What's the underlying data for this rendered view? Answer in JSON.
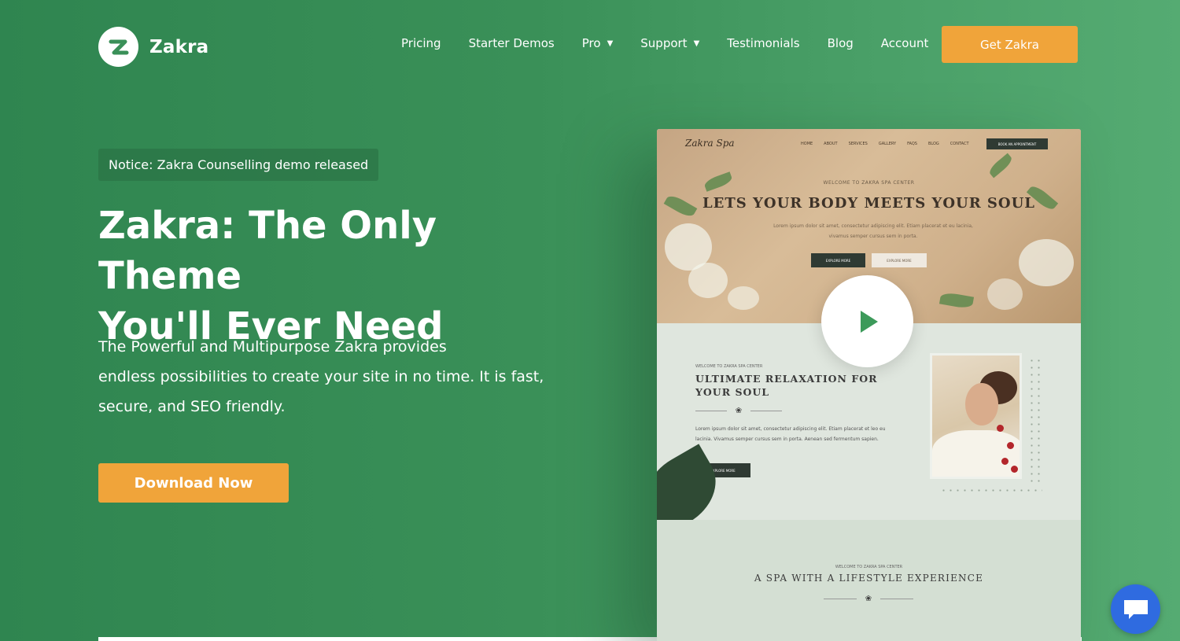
{
  "header": {
    "logo_text": "Zakra",
    "nav": [
      {
        "label": "Pricing",
        "has_dropdown": false
      },
      {
        "label": "Starter Demos",
        "has_dropdown": false
      },
      {
        "label": "Pro",
        "has_dropdown": true
      },
      {
        "label": "Support",
        "has_dropdown": true
      },
      {
        "label": "Testimonials",
        "has_dropdown": false
      },
      {
        "label": "Blog",
        "has_dropdown": false
      },
      {
        "label": "Account",
        "has_dropdown": false
      }
    ],
    "cta_label": "Get Zakra"
  },
  "hero": {
    "notice": "Notice: Zakra Counselling demo released",
    "title_line1": "Zakra: The Only Theme",
    "title_line2": "You'll Ever Need",
    "desc_line1": "The Powerful and Multipurpose Zakra provides",
    "desc_line2": "endless possibilities to create your site in no time. It is fast,",
    "desc_line3": "secure, and SEO friendly.",
    "download_label": "Download Now"
  },
  "preview": {
    "logo": "Zakra Spa",
    "menu": [
      "HOME",
      "ABOUT",
      "SERVICES",
      "GALLERY",
      "FAQS",
      "BLOG",
      "CONTACT"
    ],
    "book_label": "BOOK AN APPOINTMENT",
    "welcome": "WELCOME TO ZAKRA SPA CENTER",
    "title": "LETS YOUR BODY MEETS YOUR SOUL",
    "lorem": "Lorem ipsum dolor sit amet, consectetur adipiscing elit. Etiam placerat et eu lacinia, vivamus semper cursus sem in porta.",
    "btn1": "EXPLORE MORE",
    "btn2": "EXPLORE MORE",
    "section2": {
      "welcome": "WELCOME TO ZAKRA SPA CENTER",
      "title": "ULTIMATE RELAXATION FOR YOUR SOUL",
      "lorem": "Lorem ipsum dolor sit amet, consectetur adipiscing elit. Etiam placerat et leo eu lacinia. Vivamus semper cursus sem in porta. Aenean sed fermentum sapien.",
      "btn": "EXPLORE MORE"
    },
    "section3": {
      "welcome": "WELCOME TO ZAKRA SPA CENTER",
      "title": "A SPA WITH A LIFESTYLE EXPERIENCE"
    }
  },
  "colors": {
    "accent": "#f0a43a",
    "bg_green": "#3a9058",
    "chat_blue": "#2f6be0",
    "play_green": "#3c9a5a"
  },
  "icons": {
    "logo": "zakra-z-logo-icon",
    "dropdown": "chevron-down-icon",
    "play": "play-icon",
    "chat": "chat-bubble-icon",
    "leaf": "leaf-icon"
  }
}
